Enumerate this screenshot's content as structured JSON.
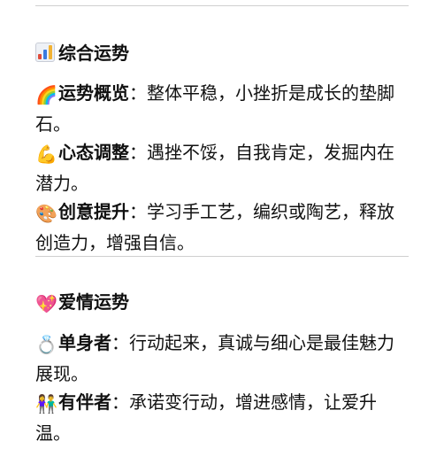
{
  "sections": [
    {
      "title": "综合运势",
      "icon": "bar-chart-icon",
      "items": [
        {
          "icon": "rainbow-icon",
          "glyph": "🌈",
          "label": "运势概览",
          "sep": "：",
          "text": "整体平稳，小挫折是成长的垫脚石。"
        },
        {
          "icon": "flexed-biceps-icon",
          "glyph": "💪",
          "label": "心态调整",
          "sep": "：",
          "text": "遇挫不馁，自我肯定，发掘内在潜力。"
        },
        {
          "icon": "artist-palette-icon",
          "glyph": "🎨",
          "label": "创意提升",
          "sep": "：",
          "text": "学习手工艺，编织或陶艺，释放创造力，增强自信。"
        }
      ]
    },
    {
      "title": "爱情运势",
      "icon": "sparkling-heart-icon",
      "glyph": "💖",
      "items": [
        {
          "icon": "ring-icon",
          "glyph": "💍",
          "label": "单身者",
          "sep": "：",
          "text": "行动起来，真诚与细心是最佳魅力展现。"
        },
        {
          "icon": "couple-icon",
          "glyph": "👫",
          "label": "有伴者",
          "sep": "：",
          "text": "承诺变行动，增进感情，让爱升温。"
        }
      ]
    }
  ]
}
